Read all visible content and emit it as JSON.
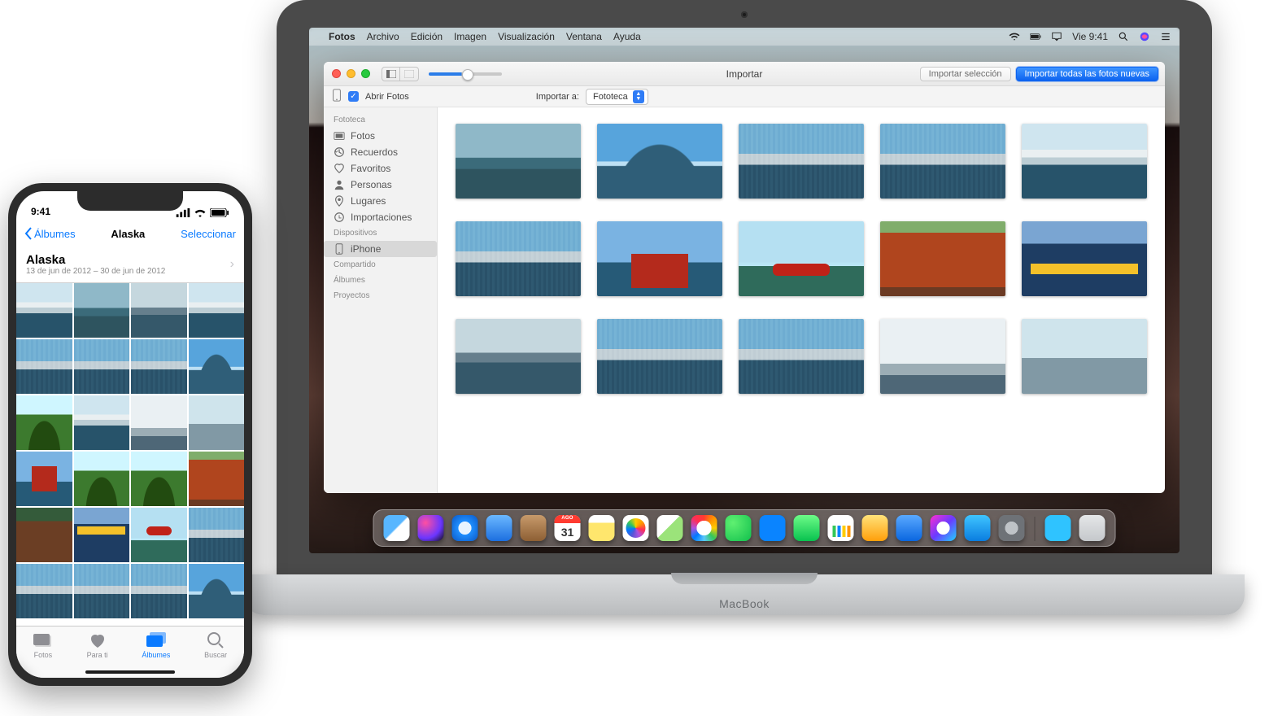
{
  "menubar": {
    "app": "Fotos",
    "items": [
      "Archivo",
      "Edición",
      "Imagen",
      "Visualización",
      "Ventana",
      "Ayuda"
    ],
    "clock": "Vie 9:41"
  },
  "window": {
    "title": "Importar",
    "btn_import_sel": "Importar selección",
    "btn_import_all": "Importar todas las fotos nuevas",
    "open_photos_label": "Abrir Fotos",
    "import_to_label": "Importar a:",
    "import_to_value": "Fototeca"
  },
  "sidebar": {
    "library_header": "Fototeca",
    "library": [
      {
        "label": "Fotos"
      },
      {
        "label": "Recuerdos"
      },
      {
        "label": "Favoritos"
      },
      {
        "label": "Personas"
      },
      {
        "label": "Lugares"
      },
      {
        "label": "Importaciones"
      }
    ],
    "devices_header": "Dispositivos",
    "device": "iPhone",
    "shared_header": "Compartido",
    "albums_header": "Álbumes",
    "projects_header": "Proyectos"
  },
  "dock": {
    "cal_month": "AGO",
    "cal_day": "31"
  },
  "iphone": {
    "time": "9:41",
    "back": "Álbumes",
    "title": "Alaska",
    "select": "Seleccionar",
    "album_name": "Alaska",
    "date_range": "13 de jun de 2012 – 30 de jun de 2012",
    "tabs": {
      "photos": "Fotos",
      "foryou": "Para ti",
      "albums": "Álbumes",
      "search": "Buscar"
    }
  },
  "macbook_brand": "MacBook"
}
